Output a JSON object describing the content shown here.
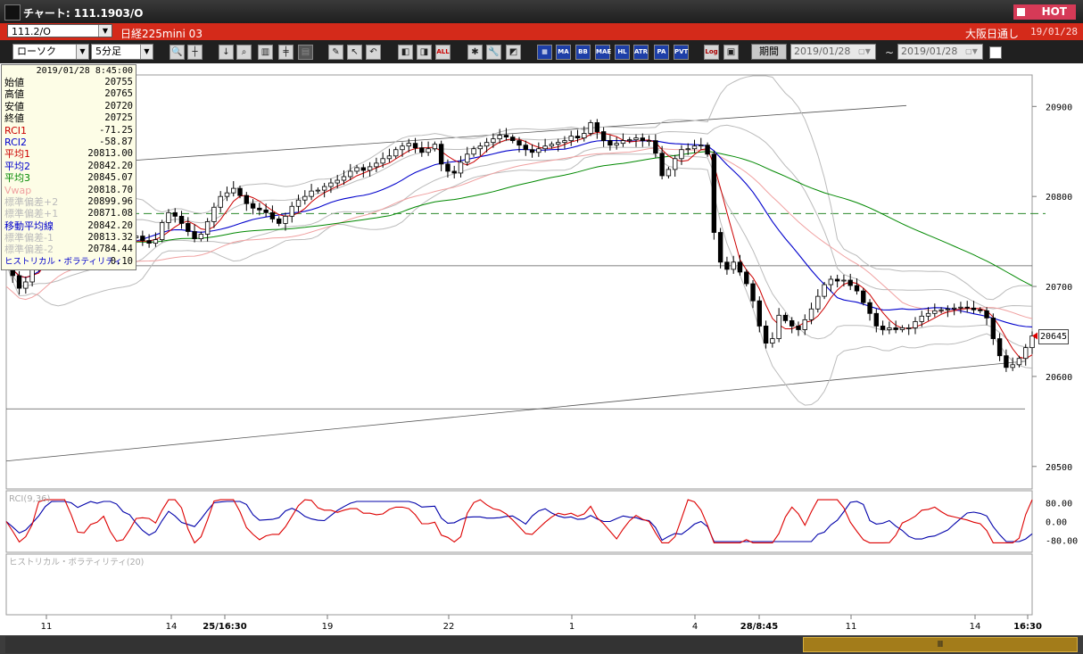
{
  "window": {
    "title": "チャート: 111.1903/O",
    "hot_label": "HOT"
  },
  "header": {
    "symbol": "111.2/O",
    "instrument": "日経225mini 03",
    "exchange": "大阪日通し",
    "date": "19/01/28"
  },
  "toolbar": {
    "chart_type": "ローソク",
    "timeframe": "5分足",
    "period_label": "期間",
    "date_from": "2019/01/28",
    "date_to": "2019/01/28",
    "tilde": "~",
    "buttons": [
      "MA",
      "BB",
      "MAE",
      "HL",
      "ATR",
      "PA",
      "PVT",
      "Log",
      "ALL"
    ]
  },
  "info_panel": {
    "datetime": "2019/01/28 8:45:00",
    "rows": [
      {
        "label": "始値",
        "value": "20755",
        "color": "#000000"
      },
      {
        "label": "高値",
        "value": "20765",
        "color": "#000000"
      },
      {
        "label": "安値",
        "value": "20720",
        "color": "#000000"
      },
      {
        "label": "終値",
        "value": "20725",
        "color": "#000000"
      },
      {
        "label": "RCI1",
        "value": "-71.25",
        "color": "#cc0000"
      },
      {
        "label": "RCI2",
        "value": "-58.87",
        "color": "#0000cc"
      },
      {
        "label": "平均1",
        "value": "20813.00",
        "color": "#cc0000"
      },
      {
        "label": "平均2",
        "value": "20842.20",
        "color": "#0000cc"
      },
      {
        "label": "平均3",
        "value": "20845.07",
        "color": "#008800"
      },
      {
        "label": "Vwap",
        "value": "20818.70",
        "color": "#f0a0a0"
      },
      {
        "label": "標準偏差+2",
        "value": "20899.96",
        "color": "#bbbbbb"
      },
      {
        "label": "標準偏差+1",
        "value": "20871.08",
        "color": "#bbbbbb"
      },
      {
        "label": "移動平均線",
        "value": "20842.20",
        "color": "#0000cc"
      },
      {
        "label": "標準偏差-1",
        "value": "20813.32",
        "color": "#bbbbbb"
      },
      {
        "label": "標準偏差-2",
        "value": "20784.44",
        "color": "#bbbbbb"
      },
      {
        "label": "ヒストリカル・ボラティリティ",
        "value": "0.10",
        "color": "#0000cc"
      }
    ]
  },
  "price_axis": {
    "ticks": [
      "20900",
      "20800",
      "20700",
      "20600",
      "20500"
    ],
    "last_price": "20645"
  },
  "rci_panel": {
    "label": "RCI(9,36)",
    "ticks": [
      "80.00",
      "0.00",
      "-80.00"
    ]
  },
  "hv_panel": {
    "label": "ヒストリカル・ボラティリティ(20)"
  },
  "time_axis": {
    "ticks": [
      "11",
      "14",
      "25/16:30",
      "19",
      "22",
      "1",
      "4",
      "28/8:45",
      "11",
      "14",
      "16:30"
    ]
  },
  "scroll_thumb": "Ⅲ",
  "chart_data": {
    "type": "candlestick",
    "y_range": [
      20475,
      20935
    ],
    "colors": {
      "ma1": "#cc0000",
      "ma2": "#0000cc",
      "ma3": "#008800",
      "vwap": "#f0a0a0",
      "band": "#bbbbbb",
      "up": "#ffffff",
      "down": "#000000",
      "rci1": "#dd0000",
      "rci2": "#0000aa",
      "hv": "#1a5fd0"
    },
    "prices": [
      20725,
      20712,
      20698,
      20705,
      20721,
      20738,
      20760,
      20772,
      20780,
      20776,
      20769,
      20758,
      20765,
      20772,
      20768,
      20765,
      20752,
      20746,
      20744,
      20754,
      20756,
      20751,
      20748,
      20752,
      20771,
      20782,
      20778,
      20770,
      20761,
      20753,
      20758,
      20772,
      20788,
      20800,
      20804,
      20809,
      20801,
      20792,
      20787,
      20785,
      20782,
      20775,
      20770,
      20778,
      20789,
      20796,
      20800,
      20806,
      20807,
      20811,
      20815,
      20818,
      20822,
      20828,
      20832,
      20829,
      20833,
      20837,
      20842,
      20845,
      20852,
      20856,
      20859,
      20854,
      20849,
      20853,
      20858,
      20836,
      20828,
      20826,
      20838,
      20847,
      20853,
      20856,
      20860,
      20864,
      20868,
      20866,
      20862,
      20857,
      20852,
      20849,
      20853,
      20856,
      20858,
      20860,
      20862,
      20867,
      20865,
      20870,
      20882,
      20872,
      20862,
      20857,
      20859,
      20862,
      20863,
      20865,
      20862,
      20862,
      20848,
      20823,
      20830,
      20842,
      20852,
      20853,
      20856,
      20857,
      20847,
      20760,
      20727,
      20719,
      20727,
      20716,
      20703,
      20684,
      20656,
      20637,
      20642,
      20668,
      20662,
      20656,
      20652,
      20663,
      20675,
      20689,
      20702,
      20708,
      20706,
      20707,
      20701,
      20695,
      20682,
      20670,
      20656,
      20652,
      20654,
      20652,
      20654,
      20654,
      20661,
      20667,
      20670,
      20673,
      20674,
      20675,
      20676,
      20677,
      20676,
      20674,
      20673,
      20665,
      20642,
      20623,
      20610,
      20613,
      20620,
      20632,
      20645
    ],
    "annotations": {
      "trendline_upper": [
        [
          0,
          20830
        ],
        [
          1016,
          20901
        ]
      ],
      "trendline_lower": [
        [
          0,
          20506
        ],
        [
          1150,
          20617
        ]
      ],
      "dashed_level": 20781,
      "h_level_1": 20723,
      "h_level_2": 20564
    }
  }
}
